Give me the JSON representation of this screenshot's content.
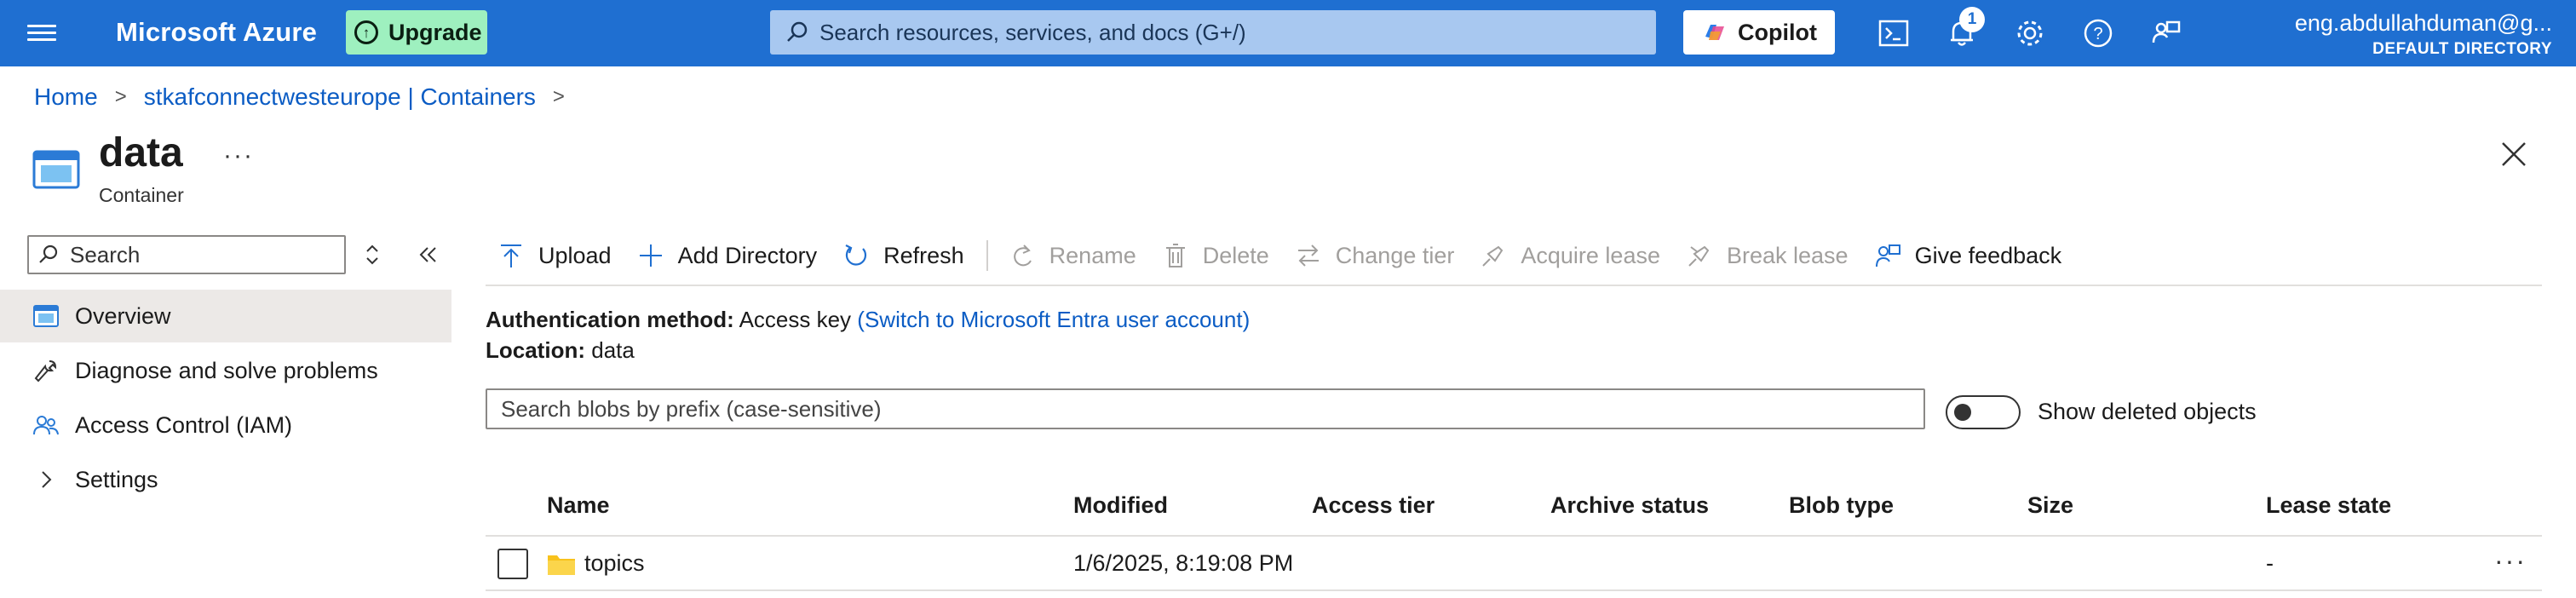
{
  "topbar": {
    "brand": "Microsoft Azure",
    "upgrade_label": "Upgrade",
    "search_placeholder": "Search resources, services, and docs (G+/)",
    "copilot_label": "Copilot",
    "notification_count": "1",
    "account_email": "eng.abdullahduman@g...",
    "account_directory": "DEFAULT DIRECTORY",
    "bar_color": "#1f6fd1",
    "upgrade_color": "#9ef0bf"
  },
  "breadcrumb": {
    "items": [
      "Home",
      "stkafconnectwesteurope | Containers"
    ],
    "separator": ">"
  },
  "header": {
    "title": "data",
    "subtitle": "Container",
    "more": "···"
  },
  "nav": {
    "search_placeholder": "Search",
    "items": [
      {
        "label": "Overview",
        "icon": "container-icon",
        "active": true
      },
      {
        "label": "Diagnose and solve problems",
        "icon": "wrench-icon"
      },
      {
        "label": "Access Control (IAM)",
        "icon": "people-icon"
      },
      {
        "label": "Settings",
        "icon": "chevron-right-icon"
      }
    ]
  },
  "toolbar": {
    "upload": "Upload",
    "add_directory": "Add Directory",
    "refresh": "Refresh",
    "rename": "Rename",
    "delete": "Delete",
    "change_tier": "Change tier",
    "acquire_lease": "Acquire lease",
    "break_lease": "Break lease",
    "give_feedback": "Give feedback"
  },
  "info": {
    "auth_label": "Authentication method:",
    "auth_value": "Access key",
    "auth_link": "(Switch to Microsoft Entra user account)",
    "location_label": "Location:",
    "location_value": "data"
  },
  "blobs": {
    "search_placeholder": "Search blobs by prefix (case-sensitive)",
    "show_deleted_label": "Show deleted objects",
    "show_deleted": false,
    "columns": [
      "Name",
      "Modified",
      "Access tier",
      "Archive status",
      "Blob type",
      "Size",
      "Lease state"
    ],
    "rows": [
      {
        "name": "topics",
        "icon": "folder-icon",
        "modified": "1/6/2025, 8:19:08 PM",
        "access_tier": "",
        "archive_status": "",
        "blob_type": "",
        "size": "",
        "lease_state": "-"
      }
    ]
  }
}
